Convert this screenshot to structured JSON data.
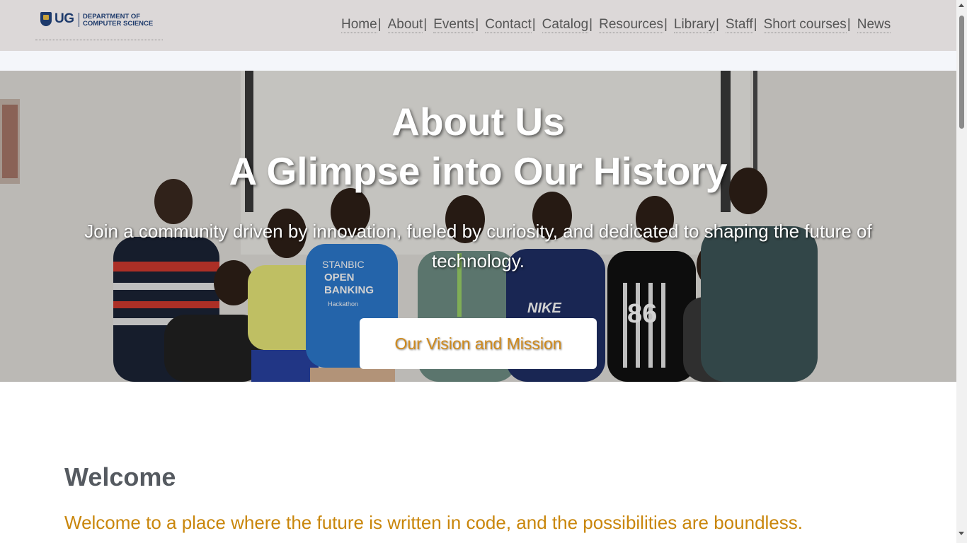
{
  "header": {
    "logo": {
      "short": "UG",
      "line1": "DEPARTMENT OF",
      "line2": "COMPUTER SCIENCE"
    },
    "nav": [
      {
        "label": "Home",
        "separator": "|"
      },
      {
        "label": "About",
        "separator": "|"
      },
      {
        "label": "Events",
        "separator": "|"
      },
      {
        "label": "Contact",
        "separator": "|"
      },
      {
        "label": "Catalog",
        "separator": "|"
      },
      {
        "label": "Resources",
        "separator": "|"
      },
      {
        "label": "Library",
        "separator": "|"
      },
      {
        "label": "Staff",
        "separator": "|"
      },
      {
        "label": "Short courses",
        "separator": "|"
      },
      {
        "label": "News",
        "separator": ""
      }
    ]
  },
  "hero": {
    "title_line1": "About Us",
    "title_line2": "A Glimpse into Our History",
    "subtitle": "Join a community driven by innovation, fueled by curiosity, and dedicated to shaping the future of technology.",
    "button_label": "Our Vision and Mission",
    "shirt_texts": [
      "STANBIC",
      "OPEN",
      "BANKING",
      "Hackathon",
      "NIKE",
      "86"
    ]
  },
  "welcome": {
    "title": "Welcome",
    "text": "Welcome to a place where the future is written in code, and the possibilities are boundless."
  },
  "colors": {
    "header_bg": "#dcd8d8",
    "accent": "#c9860b",
    "button_text": "#d08a1c",
    "logo_blue": "#1d3a6b"
  }
}
